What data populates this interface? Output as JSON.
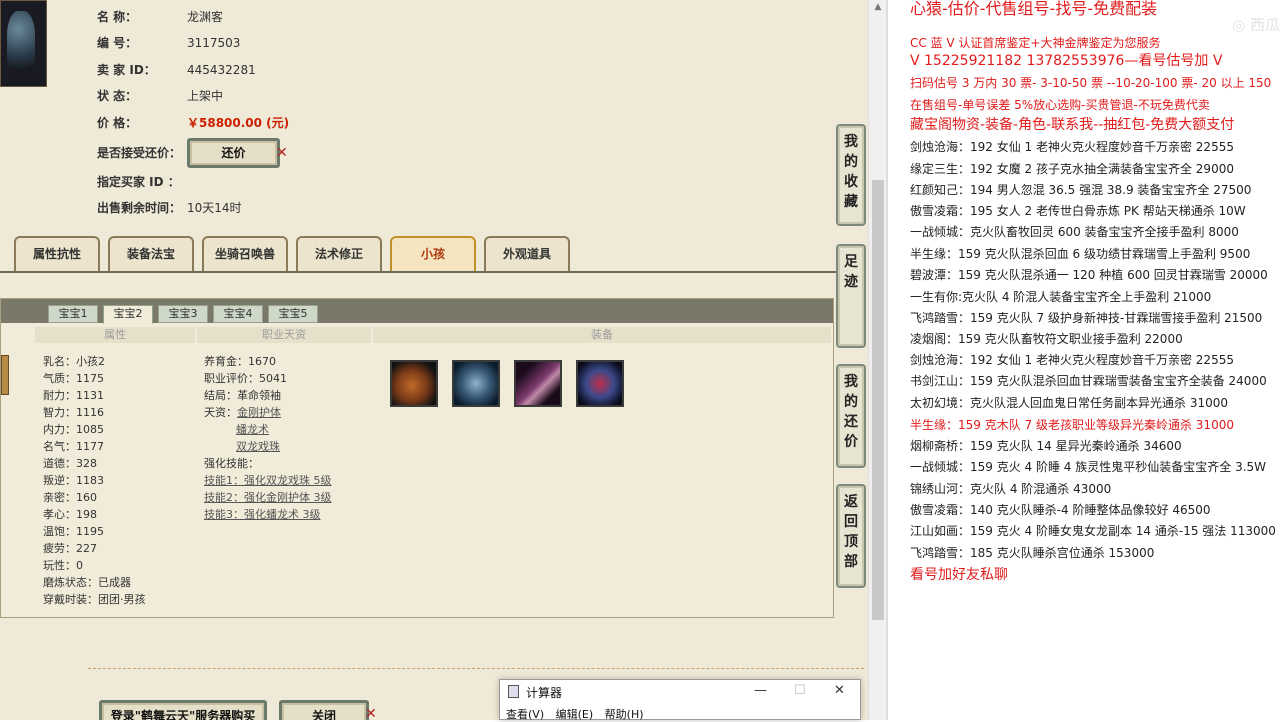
{
  "detail": {
    "rows": [
      {
        "label": "名      称：",
        "value": "龙渊客"
      },
      {
        "label": "编      号：",
        "value": "3117503"
      },
      {
        "label": "卖  家  ID：",
        "value": "445432281"
      },
      {
        "label": "状      态：",
        "value": "上架中"
      },
      {
        "label": "价      格：",
        "value": "￥58800.00 (元)"
      },
      {
        "label": "是否接受还价：",
        "value": ""
      },
      {
        "label": "指定买家 ID ：",
        "value": ""
      },
      {
        "label": "出售剩余时间：",
        "value": "10天14时"
      }
    ],
    "counter_offer_label": "还价"
  },
  "tabs": [
    "属性抗性",
    "装备法宝",
    "坐骑召唤兽",
    "法术修正",
    "小孩",
    "外观道具"
  ],
  "active_tab": "小孩",
  "subtabs": [
    "宝宝1",
    "宝宝2",
    "宝宝3",
    "宝宝4",
    "宝宝5"
  ],
  "active_subtab": "宝宝2",
  "columns": [
    "属性",
    "职业天资",
    "装备"
  ],
  "child": {
    "attributes": [
      {
        "k": "乳名：",
        "v": "小孩2"
      },
      {
        "k": "气质：",
        "v": "1175"
      },
      {
        "k": "耐力：",
        "v": "1131"
      },
      {
        "k": "智力：",
        "v": "1116"
      },
      {
        "k": "内力：",
        "v": "1085"
      },
      {
        "k": "名气：",
        "v": "1177"
      },
      {
        "k": "道德：",
        "v": "328"
      },
      {
        "k": "叛逆：",
        "v": "1183"
      },
      {
        "k": "亲密：",
        "v": "160"
      },
      {
        "k": "孝心：",
        "v": "198"
      },
      {
        "k": "温饱：",
        "v": "1195"
      },
      {
        "k": "疲劳：",
        "v": "227"
      },
      {
        "k": "玩性：",
        "v": "0"
      },
      {
        "k": "磨炼状态：",
        "v": "已成器"
      },
      {
        "k": "穿戴时装：",
        "v": "团团·男孩"
      }
    ],
    "talent": {
      "raise_gold_label": "养育金：",
      "raise_gold": "1670",
      "job_eval_label": "职业评价：",
      "job_eval": "5041",
      "ending_label": "结局：",
      "ending": "革命领袖",
      "talent_label": "天资：",
      "talents": [
        "金刚护体",
        "蟠龙术",
        "双龙戏珠"
      ],
      "skills_label": "强化技能：",
      "skills": [
        "技能1：强化双龙戏珠 5级",
        "技能2：强化金刚护体 3级",
        "技能3：强化蟠龙术 3级"
      ]
    }
  },
  "side_buttons": [
    "我的收藏",
    "足迹",
    "我的还价",
    "返回顶部"
  ],
  "bottom_buttons": [
    "登录\"鹤舞云天\"服务器购买",
    "关闭"
  ],
  "right_panel": {
    "headline": "心猿-估价-代售组号-找号-免费配装",
    "lines": [
      {
        "t": "CC 蓝 V 认证首席鉴定+大神金牌鉴定为您服务",
        "c": "red"
      },
      {
        "t": "V 15225921182      13782553976—看号估号加 V",
        "c": "red",
        "s": "h"
      },
      {
        "t": "扫码估号 3 万内 30 票- 3-10-50 票  --10-20-100 票- 20 以上 150",
        "c": "red"
      },
      {
        "t": "在售组号-单号误差 5%放心选购-买贵管退-不玩免费代卖",
        "c": "red"
      },
      {
        "t": "藏宝阁物资-装备-角色-联系我--抽红包-免费大额支付",
        "c": "red",
        "s": "h"
      },
      {
        "t": "剑烛沧海：192 女仙 1 老神火克火程度妙音千万亲密 22555",
        "c": ""
      },
      {
        "t": "缘定三生：192 女魔 2 孩子克水抽全满装备宝宝齐全 29000",
        "c": ""
      },
      {
        "t": "红颜知己：194 男人忽混 36.5 强混 38.9 装备宝宝齐全 27500",
        "c": ""
      },
      {
        "t": "傲雪凌霜：195 女人 2 老传世白骨赤炼 PK 帮站天梯通杀 10W",
        "c": ""
      },
      {
        "t": "一战倾城：克火队畜牧回灵 600 装备宝宝齐全接手盈利 8000",
        "c": ""
      },
      {
        "t": "半生缘：159 克火队混杀回血 6 级功绩甘霖瑞雪上手盈利 9500",
        "c": ""
      },
      {
        "t": "碧波潭：159 克火队混杀通一 120 种植 600 回灵甘霖瑞雪 20000",
        "c": ""
      },
      {
        "t": "一生有你:克火队 4 阶混人装备宝宝齐全上手盈利 21000",
        "c": ""
      },
      {
        "t": "飞鸿踏雪：159 克火队 7 级护身新神技-甘霖瑞雪接手盈利 21500",
        "c": ""
      },
      {
        "t": "凌烟阁：159 克火队畜牧符文职业接手盈利 22000",
        "c": ""
      },
      {
        "t": "剑烛沧海：192 女仙 1 老神火克火程度妙音千万亲密 22555",
        "c": ""
      },
      {
        "t": "书剑江山：159 克火队混杀回血甘霖瑞雪装备宝宝齐全装备 24000",
        "c": ""
      },
      {
        "t": "太初幻境：克火队混人回血鬼日常任务副本异光通杀 31000",
        "c": ""
      },
      {
        "t": "半生缘：159 克木队 7 级老孩职业等级异光秦岭通杀 31000",
        "c": "red"
      },
      {
        "t": "烟柳斋桥：159 克火队 14 星异光秦岭通杀 34600",
        "c": ""
      },
      {
        "t": "一战倾城：159 克火 4 阶睡 4 族灵性鬼平秒仙装备宝宝齐全 3.5W",
        "c": ""
      },
      {
        "t": "锦绣山河：克火队 4 阶混通杀 43000",
        "c": ""
      },
      {
        "t": "傲雪凌霜：140 克火队睡杀-4 阶睡整体品像较好 46500",
        "c": ""
      },
      {
        "t": "江山如画：159 克火 4 阶睡女鬼女龙副本 14 通杀-15 强法 113000",
        "c": ""
      },
      {
        "t": "飞鸿踏雪：185 克火队睡杀宫位通杀 153000",
        "c": ""
      },
      {
        "t": "看号加好友私聊",
        "c": "red",
        "s": "h"
      }
    ]
  },
  "calculator": {
    "title": "计算器",
    "menu": [
      "查看(V)",
      "编辑(E)",
      "帮助(H)"
    ]
  },
  "colors": {
    "page_bg": "#efe9d8",
    "price": "#cc1f00",
    "accent_red": "#e21b1b",
    "active_tab": "#b03a10"
  }
}
